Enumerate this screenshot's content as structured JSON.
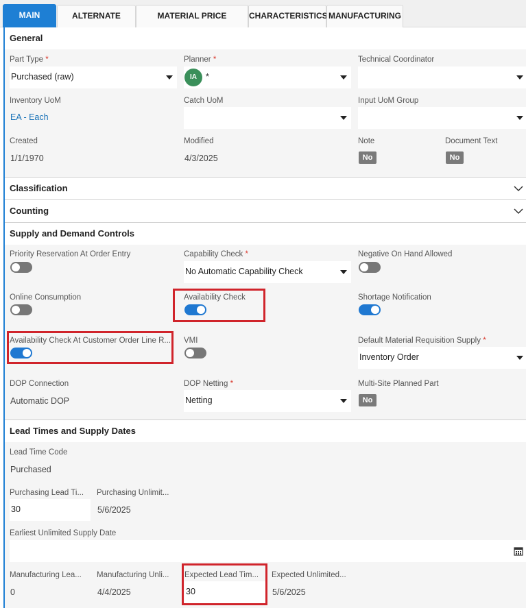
{
  "tabs": [
    {
      "label": "MAIN",
      "active": true
    },
    {
      "label": "ALTERNATE PARTS"
    },
    {
      "label": "MATERIAL PRICE ELEMENTS"
    },
    {
      "label": "CHARACTERISTICS"
    },
    {
      "label": "MANUFACTURING"
    }
  ],
  "general": {
    "title": "General",
    "part_type": {
      "label": "Part Type",
      "value": "Purchased (raw)"
    },
    "planner": {
      "label": "Planner",
      "avatar": "IA",
      "value": "*"
    },
    "technical_coordinator": {
      "label": "Technical Coordinator",
      "value": ""
    },
    "inventory_uom": {
      "label": "Inventory UoM",
      "value": "EA - Each"
    },
    "catch_uom": {
      "label": "Catch UoM",
      "value": ""
    },
    "input_uom_group": {
      "label": "Input UoM Group",
      "value": ""
    },
    "created": {
      "label": "Created",
      "value": "1/1/1970"
    },
    "modified": {
      "label": "Modified",
      "value": "4/3/2025"
    },
    "note": {
      "label": "Note",
      "value": "No"
    },
    "document_text": {
      "label": "Document Text",
      "value": "No"
    }
  },
  "classification": {
    "title": "Classification"
  },
  "counting": {
    "title": "Counting"
  },
  "supply": {
    "title": "Supply and Demand Controls",
    "priority_reservation": {
      "label": "Priority Reservation At Order Entry",
      "on": false
    },
    "capability_check": {
      "label": "Capability Check",
      "value": "No Automatic Capability Check"
    },
    "negative_on_hand": {
      "label": "Negative On Hand Allowed",
      "on": false
    },
    "online_consumption": {
      "label": "Online Consumption",
      "on": false
    },
    "availability_check": {
      "label": "Availability Check",
      "on": true
    },
    "shortage_notification": {
      "label": "Shortage Notification",
      "on": true
    },
    "availability_check_col": {
      "label": "Availability Check At Customer Order Line R...",
      "on": true
    },
    "vmi": {
      "label": "VMI",
      "on": false
    },
    "default_material_req": {
      "label": "Default Material Requisition Supply",
      "value": "Inventory Order"
    },
    "dop_connection": {
      "label": "DOP Connection",
      "value": "Automatic DOP"
    },
    "dop_netting": {
      "label": "DOP Netting",
      "value": "Netting"
    },
    "multi_site": {
      "label": "Multi-Site Planned Part",
      "value": "No"
    }
  },
  "lead": {
    "title": "Lead Times and Supply Dates",
    "lead_time_code": {
      "label": "Lead Time Code",
      "value": "Purchased"
    },
    "purchasing_lead_time": {
      "label": "Purchasing Lead Ti...",
      "value": "30"
    },
    "purchasing_unlimited": {
      "label": "Purchasing Unlimit...",
      "value": "5/6/2025"
    },
    "earliest_unlimited": {
      "label": "Earliest Unlimited Supply Date",
      "value": ""
    },
    "manufacturing_lead": {
      "label": "Manufacturing Lea...",
      "value": "0"
    },
    "manufacturing_unlimited": {
      "label": "Manufacturing Unli...",
      "value": "4/4/2025"
    },
    "expected_lead": {
      "label": "Expected Lead Tim...",
      "value": "30"
    },
    "expected_unlimited": {
      "label": "Expected Unlimited...",
      "value": "5/6/2025"
    }
  },
  "colors": {
    "accent": "#1e7fd4",
    "highlight": "#d0242b",
    "toggle_on": "#1f78d1",
    "avatar": "#3a8f5a"
  }
}
